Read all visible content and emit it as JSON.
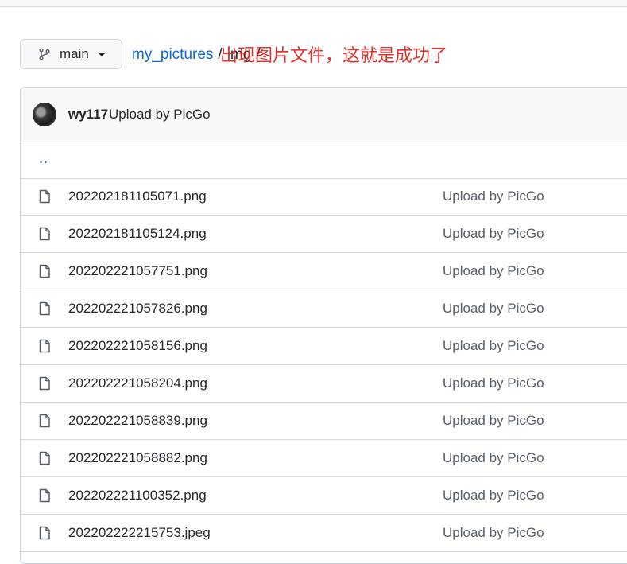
{
  "branch": {
    "name": "main",
    "icon": "git-branch-icon"
  },
  "breadcrumb": {
    "repo": "my_pictures",
    "sep1": "/",
    "folder": "img",
    "sep2": "/"
  },
  "commit": {
    "user": "wy117",
    "message": "Upload by PicGo"
  },
  "annotation": "出现图片文件，这就是成功了",
  "parent_dir": "..",
  "files": [
    {
      "name": "202202181105071.png",
      "message": "Upload by PicGo"
    },
    {
      "name": "202202181105124.png",
      "message": "Upload by PicGo"
    },
    {
      "name": "202202221057751.png",
      "message": "Upload by PicGo"
    },
    {
      "name": "202202221057826.png",
      "message": "Upload by PicGo"
    },
    {
      "name": "202202221058156.png",
      "message": "Upload by PicGo"
    },
    {
      "name": "202202221058204.png",
      "message": "Upload by PicGo"
    },
    {
      "name": "202202221058839.png",
      "message": "Upload by PicGo"
    },
    {
      "name": "202202221058882.png",
      "message": "Upload by PicGo"
    },
    {
      "name": "202202221100352.png",
      "message": "Upload by PicGo"
    },
    {
      "name": "202202222215753.jpeg",
      "message": "Upload by PicGo"
    }
  ],
  "colors": {
    "link": "#0969da",
    "annotation": "#e5322d",
    "border": "#d0d7de"
  }
}
